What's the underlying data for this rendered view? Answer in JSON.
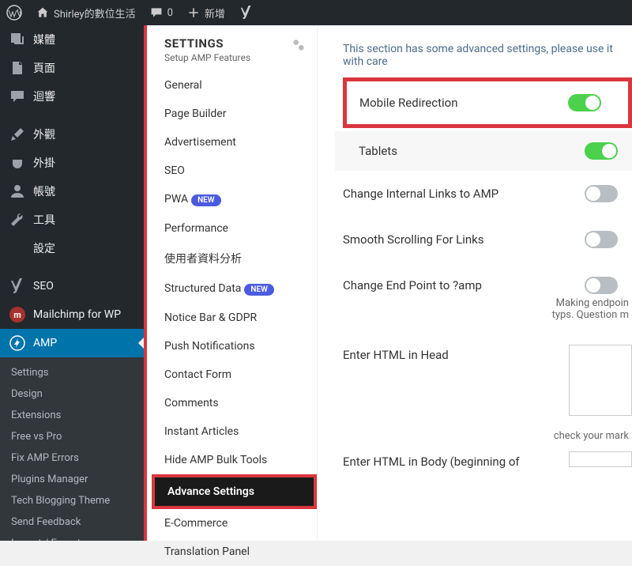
{
  "topbar": {
    "site_name": "Shirley的數位生活",
    "comments_count": "0",
    "add_new": "新增"
  },
  "sidebar": {
    "items": [
      {
        "label": "媒體"
      },
      {
        "label": "頁面"
      },
      {
        "label": "迴響"
      },
      {
        "label": "外觀"
      },
      {
        "label": "外掛"
      },
      {
        "label": "帳號"
      },
      {
        "label": "工具"
      },
      {
        "label": "設定"
      },
      {
        "label": "SEO"
      },
      {
        "label": "Mailchimp for WP"
      },
      {
        "label": "AMP"
      }
    ],
    "amp_sub": [
      "Settings",
      "Design",
      "Extensions",
      "Free vs Pro",
      "Fix AMP Errors",
      "Plugins Manager",
      "Tech Blogging Theme",
      "Send Feedback",
      "Import / Export"
    ]
  },
  "settings_nav": {
    "header_title": "SETTINGS",
    "header_sub": "Setup AMP Features",
    "items": [
      {
        "label": "General"
      },
      {
        "label": "Page Builder"
      },
      {
        "label": "Advertisement"
      },
      {
        "label": "SEO"
      },
      {
        "label": "PWA",
        "badge": "NEW"
      },
      {
        "label": "Performance"
      },
      {
        "label": "使用者資料分析"
      },
      {
        "label": "Structured Data",
        "badge": "NEW"
      },
      {
        "label": "Notice Bar & GDPR"
      },
      {
        "label": "Push Notifications"
      },
      {
        "label": "Contact Form"
      },
      {
        "label": "Comments"
      },
      {
        "label": "Instant Articles"
      },
      {
        "label": "Hide AMP Bulk Tools"
      },
      {
        "label": "Advance Settings",
        "active": true
      },
      {
        "label": "E-Commerce"
      },
      {
        "label": "Translation Panel"
      }
    ]
  },
  "panel": {
    "warning": "This section has some advanced settings, please use it with care",
    "options": {
      "mobile_redirect": {
        "label": "Mobile Redirection",
        "on": true,
        "boxed": true
      },
      "tablets": {
        "label": "Tablets",
        "on": true,
        "sub": true
      },
      "internal_links": {
        "label": "Change Internal Links to AMP",
        "on": false
      },
      "smooth_scroll": {
        "label": "Smooth Scrolling For Links",
        "on": false
      },
      "endpoint": {
        "label": "Change End Point to ?amp",
        "on": false,
        "desc": "Making endpoin\ntyps. Question m"
      },
      "html_head": {
        "label": "Enter HTML in Head",
        "check": "check your mark"
      },
      "html_body": {
        "label": "Enter HTML in Body (beginning of"
      }
    }
  }
}
